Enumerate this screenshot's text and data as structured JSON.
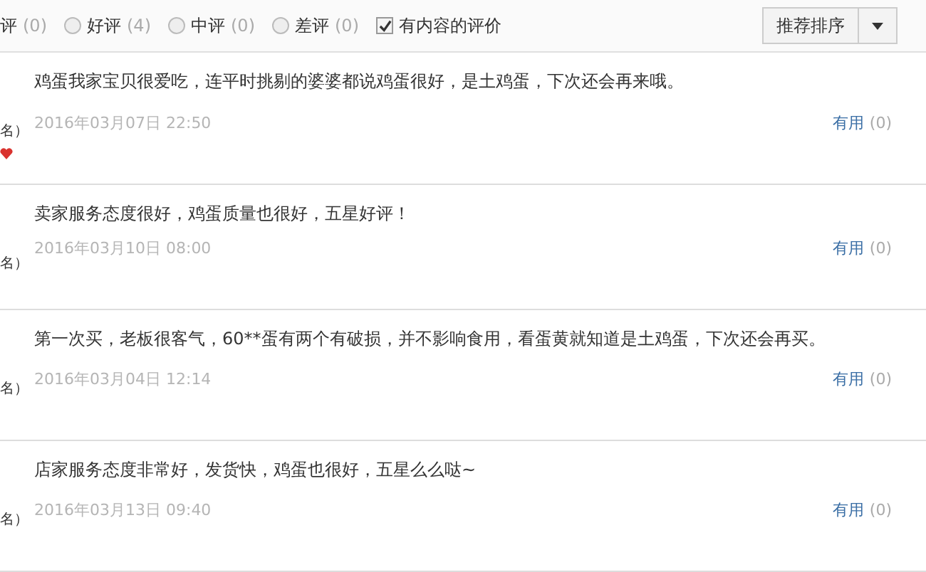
{
  "filters": [
    {
      "kind": "text",
      "label": "评",
      "count": "(0)"
    },
    {
      "kind": "radio",
      "label": "好评",
      "count": "(4)",
      "selected": false
    },
    {
      "kind": "radio",
      "label": "中评",
      "count": "(0)",
      "selected": false
    },
    {
      "kind": "radio",
      "label": "差评",
      "count": "(0)",
      "selected": false
    }
  ],
  "content_filter": {
    "label": "有内容的评价",
    "checked": true
  },
  "sort_button": {
    "label": "推荐排序"
  },
  "reviews": [
    {
      "user": "名）",
      "badge": true,
      "text": "鸡蛋我家宝贝很爱吃，连平时挑剔的婆婆都说鸡蛋很好，是土鸡蛋，下次还会再来哦。",
      "date": "2016年03月07日 22:50",
      "useful": "有用",
      "useful_count": "(0)"
    },
    {
      "user": "名）",
      "badge": false,
      "text": "卖家服务态度很好，鸡蛋质量也很好，五星好评！",
      "date": "2016年03月10日 08:00",
      "useful": "有用",
      "useful_count": "(0)"
    },
    {
      "user": "名）",
      "badge": false,
      "text": "第一次买，老板很客气，60**蛋有两个有破损，并不影响食用，看蛋黄就知道是土鸡蛋，下次还会再买。",
      "date": "2016年03月04日 12:14",
      "useful": "有用",
      "useful_count": "(0)"
    },
    {
      "user": "名）",
      "badge": false,
      "text": "店家服务态度非常好，发货快，鸡蛋也很好，五星么么哒~",
      "date": "2016年03月13日 09:40",
      "useful": "有用",
      "useful_count": "(0)"
    }
  ]
}
